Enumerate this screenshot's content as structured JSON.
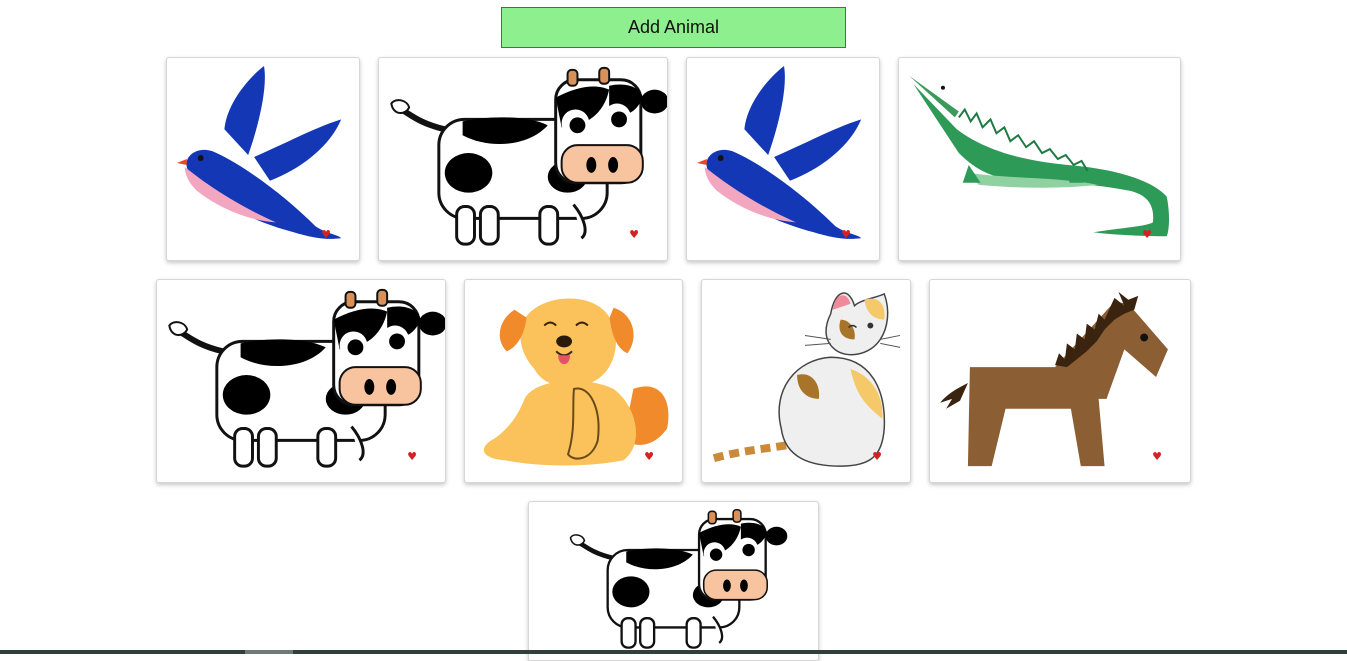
{
  "toolbar": {
    "add_label": "Add Animal"
  },
  "heart_glyph": "♥",
  "heart_color": "#d22222",
  "button_color": "#8eef8e",
  "cards": [
    {
      "animal": "bird",
      "icon": "bird-illustration"
    },
    {
      "animal": "cow",
      "icon": "cow-illustration"
    },
    {
      "animal": "bird",
      "icon": "bird-illustration"
    },
    {
      "animal": "crocodile",
      "icon": "crocodile-illustration"
    },
    {
      "animal": "cow",
      "icon": "cow-illustration"
    },
    {
      "animal": "dog",
      "icon": "dog-illustration"
    },
    {
      "animal": "cat",
      "icon": "cat-illustration"
    },
    {
      "animal": "horse",
      "icon": "horse-illustration"
    },
    {
      "animal": "cow",
      "icon": "cow-illustration"
    }
  ]
}
